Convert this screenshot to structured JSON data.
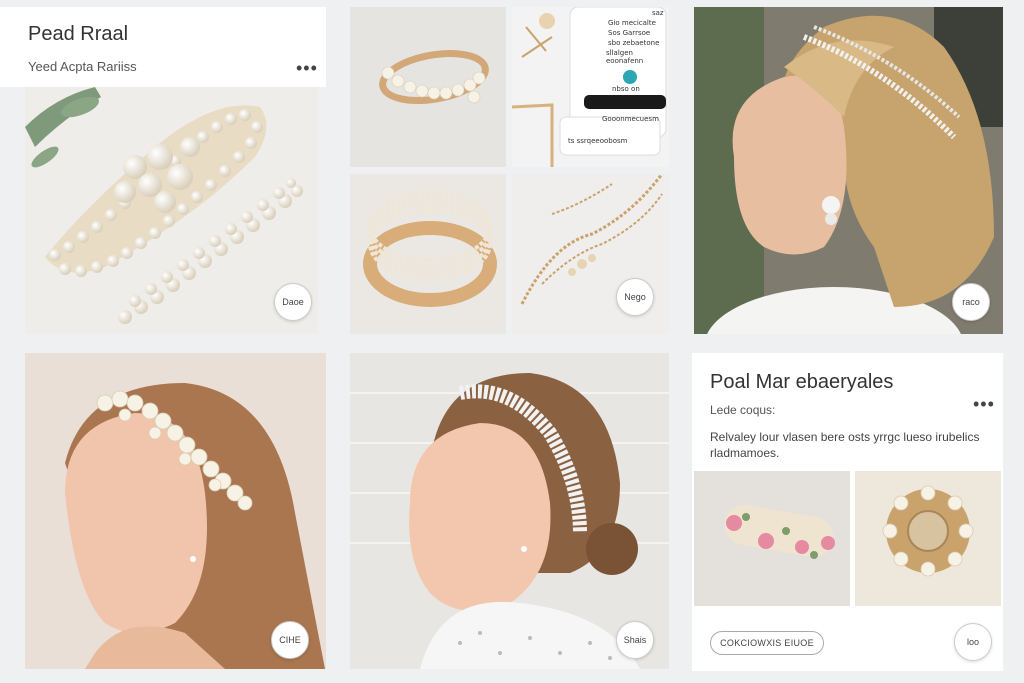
{
  "card1": {
    "title": "Pead Rraal",
    "subtitle": "Yeed Acpta Rariiss",
    "menu": "•••"
  },
  "tiles": {
    "pearl_clips": {
      "badge": "Daoe"
    },
    "chain_necklace": {
      "badge": "Nego"
    },
    "blonde_model": {
      "badge": "raco"
    },
    "pearl_headband_model": {
      "badge": "CIHE"
    },
    "crystal_headband_model": {
      "badge": "Shais"
    }
  },
  "phone_screen": {
    "header": "saz",
    "lines": [
      "Gio mecicalte",
      "Sos Garrsoe",
      "sbo zebaetone",
      "sllalgen eoonafenn"
    ],
    "label": "nbso on",
    "footer": "Gooonmecuesm",
    "caption": "ts ssrqeeoobosm"
  },
  "card2": {
    "title": "Poal Mar ebaeryales",
    "subtitle": "Lede coqus:",
    "menu": "•••",
    "description": "Relvaley lour vlasen bere osts yrrgc lueso irubelics rladmamoes.",
    "button": "COKCIOWXIS EIUOE",
    "badge": "loo"
  },
  "colors": {
    "background": "#eef0f2",
    "card": "#ffffff",
    "gold": "#c9a36b",
    "pearl": "#f4efe4"
  }
}
